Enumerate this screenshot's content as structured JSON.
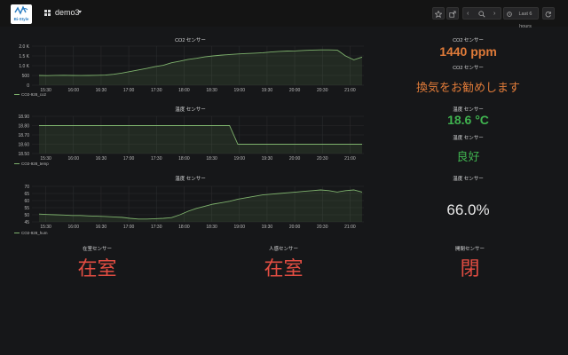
{
  "header": {
    "dashboard_title": "demo3",
    "time_range": "Last 6 hours",
    "logo_text": "Bi-Style"
  },
  "charts": {
    "co2": {
      "title": "CO2 センサー",
      "legend": "CO2-928_co2",
      "y_ticks": [
        "2.0 K",
        "1.5 K",
        "1.0 K",
        "500",
        "0"
      ],
      "x_ticks": [
        "15:30",
        "16:00",
        "16:30",
        "17:00",
        "17:30",
        "18:00",
        "18:30",
        "19:00",
        "19:30",
        "20:00",
        "20:30",
        "21:00"
      ]
    },
    "temp": {
      "title": "温度 センサー",
      "legend": "CO2-928_temp",
      "y_ticks": [
        "18.90",
        "18.80",
        "18.70",
        "18.60",
        "18.50"
      ],
      "x_ticks": [
        "15:30",
        "16:00",
        "16:30",
        "17:00",
        "17:30",
        "18:00",
        "18:30",
        "19:00",
        "19:30",
        "20:00",
        "20:30",
        "21:00"
      ]
    },
    "hum": {
      "title": "温度 センサー",
      "legend": "CO2-928_hum",
      "y_ticks": [
        "70",
        "65",
        "60",
        "55",
        "50",
        "45"
      ],
      "x_ticks": [
        "15:30",
        "16:00",
        "16:30",
        "17:00",
        "17:30",
        "18:00",
        "18:30",
        "19:00",
        "19:30",
        "20:00",
        "20:30",
        "21:00"
      ]
    }
  },
  "stats": {
    "co2_title": "CO2 センサー",
    "co2_value": "1440 ppm",
    "co2_advice_title": "CO2 センサー",
    "co2_advice": "換気をお勧めします",
    "temp_title": "温度 センサー",
    "temp_value": "18.6 °C",
    "temp_status_title": "温度 センサー",
    "temp_status": "良好",
    "hum_title": "温度 センサー",
    "hum_value": "66.0%",
    "presence_title": "在室センサー",
    "presence_value": "在室",
    "motion_title": "人感センサー",
    "motion_value": "在室",
    "door_title": "開閉センサー",
    "door_value": "閉"
  },
  "colors": {
    "series": "#7eb26d",
    "orange": "#e07b39",
    "green": "#3fb24f",
    "red": "#e24d42",
    "white": "#e8e8e8"
  },
  "chart_data": [
    {
      "type": "area",
      "title": "CO2 センサー",
      "series": [
        {
          "name": "CO2-928_co2",
          "values": [
            500,
            490,
            505,
            510,
            500,
            495,
            500,
            510,
            520,
            560,
            620,
            700,
            780,
            860,
            950,
            1020,
            1150,
            1230,
            1320,
            1380,
            1450,
            1500,
            1540,
            1570,
            1600,
            1620,
            1640,
            1660,
            1700,
            1730,
            1750,
            1760,
            1780,
            1800,
            1810,
            1810,
            1800,
            1500,
            1300,
            1440
          ]
        }
      ],
      "x_range": [
        "15:15",
        "21:15"
      ],
      "ylim": [
        0,
        2000
      ]
    },
    {
      "type": "area",
      "title": "温度 センサー",
      "series": [
        {
          "name": "CO2-928_temp",
          "values": [
            18.8,
            18.8,
            18.8,
            18.8,
            18.8,
            18.8,
            18.8,
            18.8,
            18.8,
            18.8,
            18.8,
            18.8,
            18.8,
            18.8,
            18.8,
            18.8,
            18.8,
            18.8,
            18.8,
            18.8,
            18.8,
            18.8,
            18.8,
            18.8,
            18.6,
            18.6,
            18.6,
            18.6,
            18.6,
            18.6,
            18.6,
            18.6,
            18.6,
            18.6,
            18.6,
            18.6,
            18.6,
            18.6,
            18.6,
            18.6
          ]
        }
      ],
      "x_range": [
        "15:15",
        "21:15"
      ],
      "ylim": [
        18.5,
        18.9
      ]
    },
    {
      "type": "area",
      "title": "温度 センサー",
      "series": [
        {
          "name": "CO2-928_hum",
          "values": [
            50.5,
            50.2,
            50,
            49.8,
            49.5,
            49.5,
            49.2,
            49,
            48.8,
            48.5,
            48.2,
            47.5,
            47,
            47,
            47.2,
            47.5,
            48,
            50,
            52.5,
            54.5,
            56,
            57.5,
            58.5,
            59.5,
            61,
            62,
            63,
            64,
            64.5,
            65,
            65.5,
            66,
            66.5,
            67,
            67.5,
            67,
            66,
            67,
            67.5,
            66
          ]
        }
      ],
      "x_range": [
        "15:15",
        "21:15"
      ],
      "ylim": [
        45,
        70
      ]
    }
  ]
}
